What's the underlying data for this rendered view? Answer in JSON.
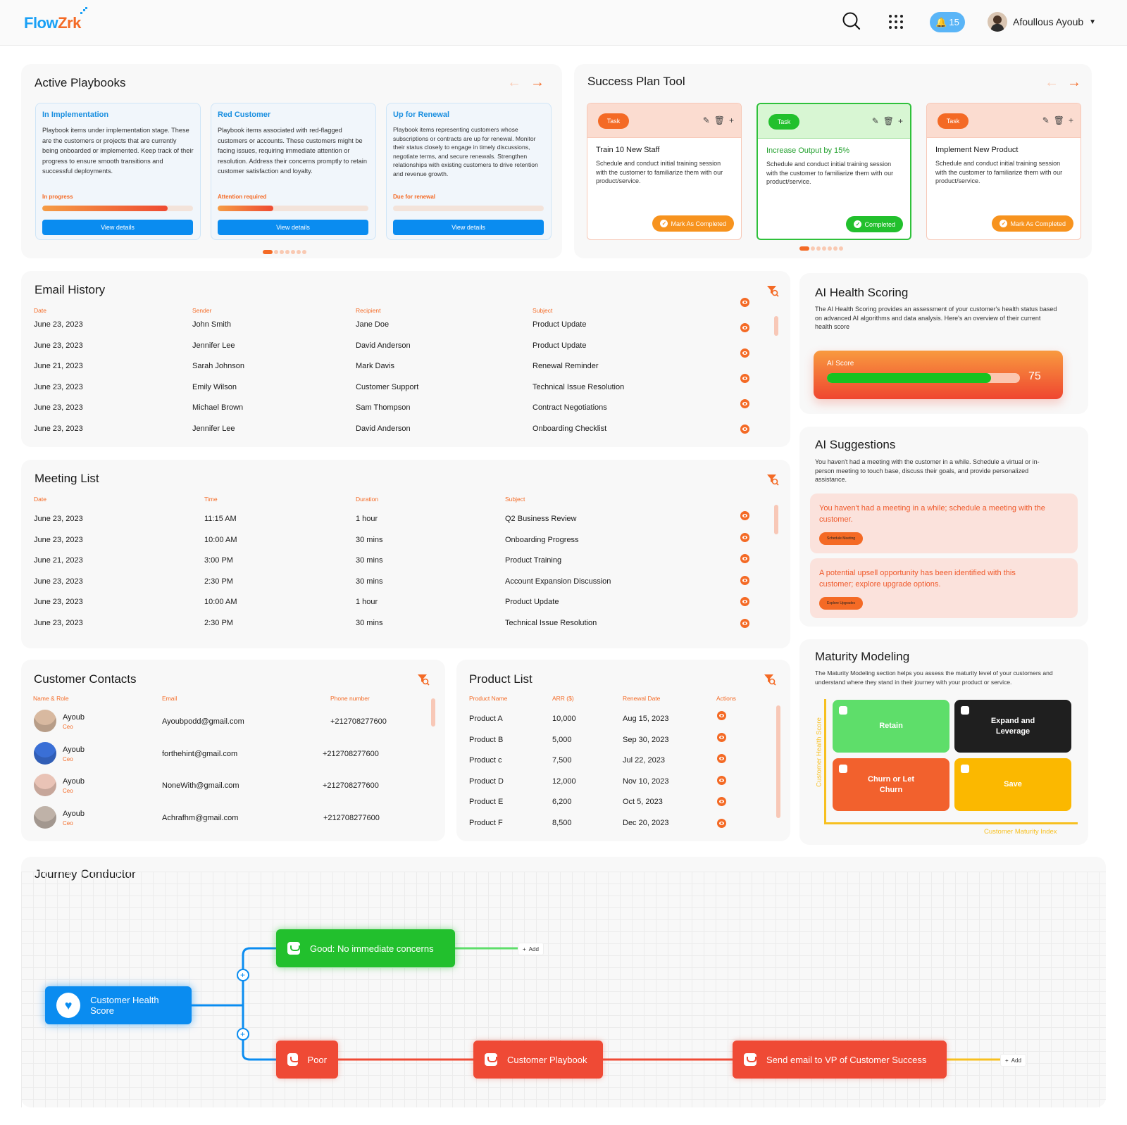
{
  "header": {
    "logo_a": "Flow",
    "logo_b": "Zrk",
    "notifications": "15",
    "user_name": "Afoullous Ayoub"
  },
  "playbooks": {
    "title": "Active Playbooks",
    "items": [
      {
        "title": "In Implementation",
        "text": "Playbook items under implementation stage. These are the customers or projects that are currently being onboarded or implemented. Keep track of their progress to ensure smooth transitions and successful deployments.",
        "status": "In progress",
        "progress": 0.83,
        "button": "View details"
      },
      {
        "title": "Red Customer",
        "text": "Playbook items associated with red-flagged customers or accounts. These customers might be facing issues, requiring immediate attention or resolution. Address their concerns promptly to retain customer satisfaction and loyalty.",
        "status": "Attention required",
        "progress": 0.37,
        "button": "View details"
      },
      {
        "title": "Up for Renewal",
        "text": "Playbook items representing customers whose subscriptions or contracts are up for renewal. Monitor their status closely to engage in timely discussions, negotiate terms, and secure renewals. Strengthen relationships with existing customers to drive retention and revenue growth.",
        "status": "Due for renewal",
        "progress": 0,
        "button": "View details"
      }
    ]
  },
  "success_plan": {
    "title": "Success Plan Tool",
    "tasks": [
      {
        "pill": "Task",
        "title": "Train 10 New Staff",
        "text": "Schedule and conduct initial training session with the customer to familiarize them with our product/service.",
        "action": "Mark As Completed"
      },
      {
        "pill": "Task",
        "title": "Increase Output by 15%",
        "text": "Schedule and conduct initial training session with the customer to familiarize them with our product/service.",
        "action": "Completed"
      },
      {
        "pill": "Task",
        "title": "Implement New Product",
        "text": "Schedule and conduct initial training session with the customer to familiarize them with our product/service.",
        "action": "Mark As Completed"
      }
    ]
  },
  "email_history": {
    "title": "Email History",
    "headers": [
      "Date",
      "Sender",
      "Recipient",
      "Subject"
    ],
    "rows": [
      [
        "June 23, 2023",
        "John Smith",
        "Jane Doe",
        "Product Update"
      ],
      [
        "June 23, 2023",
        "Jennifer Lee",
        "David Anderson",
        "Product Update"
      ],
      [
        "June 21, 2023",
        "Sarah Johnson",
        "Mark Davis",
        "Renewal Reminder"
      ],
      [
        "June 23, 2023",
        "Emily Wilson",
        "Customer Support",
        "Technical Issue Resolution"
      ],
      [
        "June 23, 2023",
        "Michael Brown",
        "Sam Thompson",
        "Contract Negotiations"
      ],
      [
        "June 23, 2023",
        "Jennifer Lee",
        "David Anderson",
        "Onboarding Checklist"
      ]
    ]
  },
  "meeting_list": {
    "title": "Meeting List",
    "headers": [
      "Date",
      "Time",
      "Duration",
      "Subject"
    ],
    "rows": [
      [
        "June 23, 2023",
        "11:15 AM",
        "1 hour",
        "Q2 Business Review"
      ],
      [
        "June 23, 2023",
        "10:00 AM",
        "30 mins",
        "Onboarding Progress"
      ],
      [
        "June 21, 2023",
        "3:00 PM",
        "30 mins",
        "Product Training"
      ],
      [
        "June 23, 2023",
        "2:30 PM",
        "30 mins",
        "Account Expansion Discussion"
      ],
      [
        "June 23, 2023",
        "10:00 AM",
        "1 hour",
        "Product Update"
      ],
      [
        "June 23, 2023",
        "2:30 PM",
        "30 mins",
        "Technical Issue Resolution"
      ]
    ]
  },
  "ai_health": {
    "title": "AI Health Scoring",
    "desc": "The AI Health Scoring provides an assessment of your customer's health status based on advanced AI algorithms and data analysis. Here's an overview of their current health score",
    "score_label": "AI Score",
    "score": "75",
    "score_fraction": 0.85
  },
  "ai_suggestions": {
    "title": "AI Suggestions",
    "desc": "You haven't had a meeting with the customer in a while. Schedule a virtual or in-person meeting to touch base, discuss their goals, and provide personalized assistance.",
    "items": [
      {
        "text": "You haven't had a meeting in a while; schedule a meeting with the customer.",
        "button": "Schedule Meeting"
      },
      {
        "text": "A potential upsell opportunity has been identified with this customer; explore upgrade options.",
        "button": "Explore Upgrades"
      }
    ]
  },
  "maturity": {
    "title": "Maturity Modeling",
    "desc": "The Maturity Modeling section helps you assess the maturity level of your customers and understand where they stand in their journey with your product or service.",
    "y_label": "Customer Health Score",
    "x_label": "Customer Maturity Index",
    "quadrants": [
      "Retain",
      "Expand and Leverage",
      "Churn or Let Churn",
      "Save"
    ]
  },
  "contacts": {
    "title": "Customer Contacts",
    "headers": [
      "Name & Role",
      "Email",
      "Phone number"
    ],
    "rows": [
      {
        "name": "Ayoub",
        "role": "Ceo",
        "email": "Ayoubpodd@gmail.com",
        "phone": "+212708277600"
      },
      {
        "name": "Ayoub",
        "role": "Ceo",
        "email": "forthehint@gmail.com",
        "phone": "+212708277600"
      },
      {
        "name": "Ayoub",
        "role": "Ceo",
        "email": "NoneWith@gmail.com",
        "phone": "+212708277600"
      },
      {
        "name": "Ayoub",
        "role": "Ceo",
        "email": "Achrafhm@gmail.com",
        "phone": "+212708277600"
      }
    ]
  },
  "products": {
    "title": "Product List",
    "headers": [
      "Product Name",
      "ARR ($)",
      "Renewal Date",
      "Actions"
    ],
    "rows": [
      [
        "Product A",
        "10,000",
        "Aug 15, 2023"
      ],
      [
        "Product B",
        "5,000",
        "Sep 30, 2023"
      ],
      [
        "Product c",
        "7,500",
        "Jul 22, 2023"
      ],
      [
        "Product D",
        "12,000",
        "Nov 10, 2023"
      ],
      [
        "Product E",
        "6,200",
        "Oct 5, 2023"
      ],
      [
        "Product F",
        "8,500",
        "Dec 20, 2023"
      ]
    ]
  },
  "journey": {
    "title": "Journey Conductor",
    "nodes": {
      "root": "Customer Health Score",
      "good": "Good: No immediate concerns",
      "poor": "Poor",
      "playbook": "Customer Playbook",
      "email": "Send email to VP of Customer Success"
    },
    "add_label": "Add"
  }
}
